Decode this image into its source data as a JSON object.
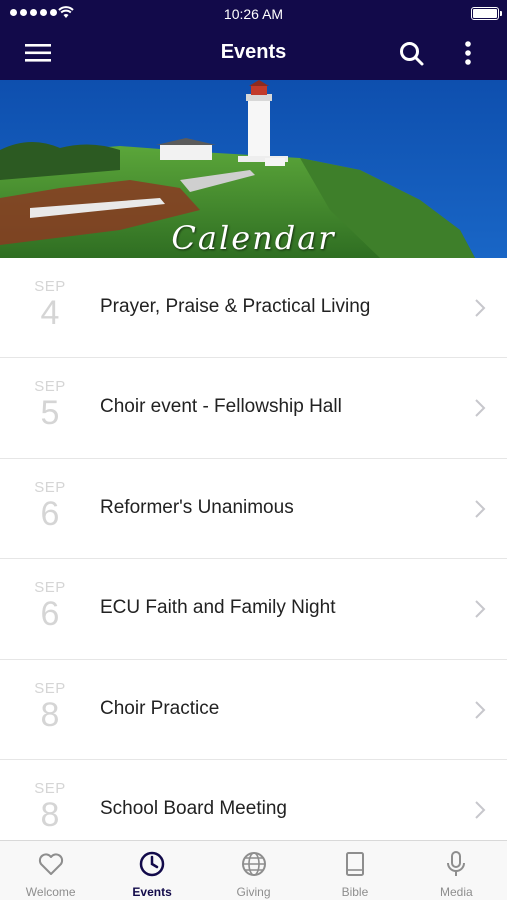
{
  "status_bar": {
    "time": "10:26 AM"
  },
  "nav": {
    "title": "Events",
    "menu_icon": "hamburger-icon",
    "search_icon": "search-icon",
    "more_icon": "more-vertical-icon",
    "bar_color": "#120a4a"
  },
  "banner": {
    "title": "Calendar"
  },
  "events": [
    {
      "month": "SEP",
      "day": "4",
      "title": "Prayer, Praise & Practical Living"
    },
    {
      "month": "SEP",
      "day": "5",
      "title": "Choir event - Fellowship Hall"
    },
    {
      "month": "SEP",
      "day": "6",
      "title": "Reformer's Unanimous"
    },
    {
      "month": "SEP",
      "day": "6",
      "title": "ECU Faith and Family Night"
    },
    {
      "month": "SEP",
      "day": "8",
      "title": "Choir Practice"
    },
    {
      "month": "SEP",
      "day": "8",
      "title": "School Board Meeting"
    }
  ],
  "tabs": [
    {
      "label": "Welcome",
      "icon": "heart-icon",
      "active": false
    },
    {
      "label": "Events",
      "icon": "clock-icon",
      "active": true
    },
    {
      "label": "Giving",
      "icon": "globe-icon",
      "active": false
    },
    {
      "label": "Bible",
      "icon": "book-icon",
      "active": false
    },
    {
      "label": "Media",
      "icon": "microphone-icon",
      "active": false
    }
  ],
  "colors": {
    "accent": "#120a4a",
    "inactive": "#8e8e8e",
    "date": "#d5d5d5"
  }
}
